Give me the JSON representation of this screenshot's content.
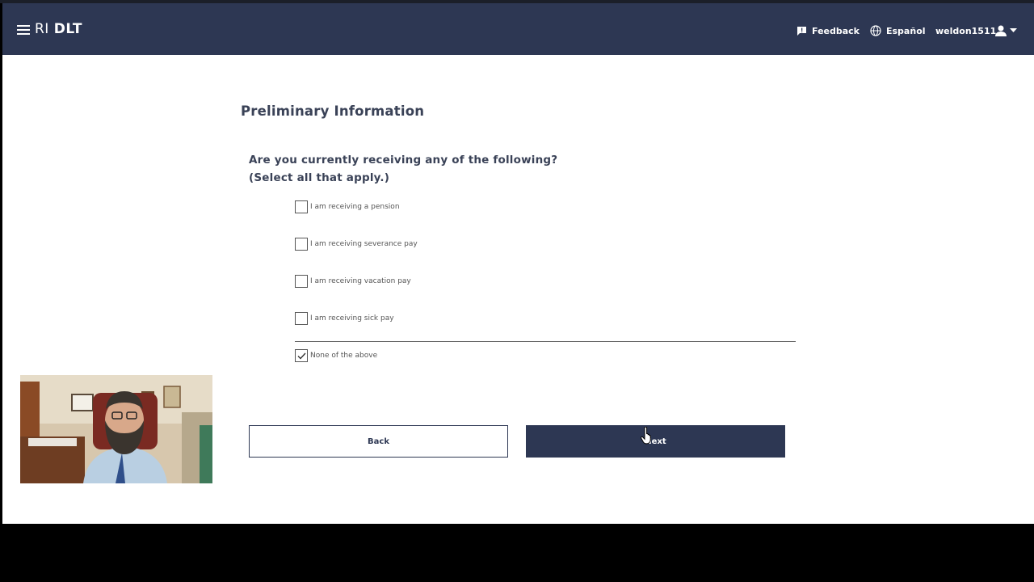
{
  "header": {
    "logo_ri": "RI",
    "logo_dlt": "DLT",
    "feedback": "Feedback",
    "language": "Español",
    "username": "weldon1511"
  },
  "form": {
    "title": "Preliminary Information",
    "question_line1": "Are you currently receiving any of the following?",
    "question_line2": "(Select all that apply.)",
    "options": [
      {
        "label": "I am receiving a pension",
        "checked": false
      },
      {
        "label": "I am receiving severance pay",
        "checked": false
      },
      {
        "label": "I am receiving vacation pay",
        "checked": false
      },
      {
        "label": "I am receiving sick pay",
        "checked": false
      },
      {
        "label": "None of the above",
        "checked": true
      }
    ],
    "back_label": "Back",
    "next_label": "Next"
  },
  "colors": {
    "header_bg": "#2d3753",
    "text": "#3a4257",
    "button_primary": "#2d3753"
  },
  "icons": {
    "menu": "hamburger-icon",
    "feedback": "feedback-icon",
    "language": "globe-icon",
    "user": "user-icon",
    "caret": "caret-down-icon"
  }
}
